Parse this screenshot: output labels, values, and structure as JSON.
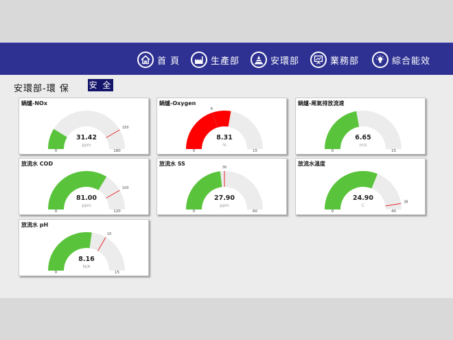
{
  "nav": {
    "items": [
      {
        "label": "首 頁",
        "icon": "home-icon"
      },
      {
        "label": "生產部",
        "icon": "factory-icon"
      },
      {
        "label": "安環部",
        "icon": "safety-cone-icon"
      },
      {
        "label": "業務部",
        "icon": "presentation-icon"
      },
      {
        "label": "綜合能效",
        "icon": "lightbulb-icon"
      }
    ]
  },
  "page": {
    "title": "安環部-環 保",
    "status": "安 全"
  },
  "colors": {
    "nav_bg": "#2e3192",
    "ok": "#59c43b",
    "alarm": "#ff0000",
    "track": "#ececec",
    "limit": "#e8262b"
  },
  "gauges": [
    {
      "title": "鍋爐-NOx",
      "value": 31.42,
      "value_text": "31.42",
      "unit": "ppm",
      "min": 0,
      "max": 180,
      "min_text": "0",
      "max_text": "180",
      "limit": 150,
      "limit_text": "150",
      "status": "normal"
    },
    {
      "title": "鍋爐-Oxygen",
      "value": 8.31,
      "value_text": "8.31",
      "unit": "%",
      "min": 0,
      "max": 15,
      "min_text": "0",
      "max_text": "15",
      "limit": 6,
      "limit_text": "6",
      "status": "alarm"
    },
    {
      "title": "鍋爐-尾氣排放流速",
      "value": 6.65,
      "value_text": "6.65",
      "unit": "m/s",
      "min": 0,
      "max": 15,
      "min_text": "0",
      "max_text": "15",
      "limit": null,
      "limit_text": "",
      "status": "normal"
    },
    {
      "title": "放流水 COD",
      "value": 81.0,
      "value_text": "81.00",
      "unit": "ppm",
      "min": 0,
      "max": 120,
      "min_text": "0",
      "max_text": "120",
      "limit": 100,
      "limit_text": "100",
      "status": "normal"
    },
    {
      "title": "放流水 SS",
      "value": 27.9,
      "value_text": "27.90",
      "unit": "ppm",
      "min": 0,
      "max": 60,
      "min_text": "0",
      "max_text": "60",
      "limit": 30,
      "limit_text": "30",
      "status": "normal"
    },
    {
      "title": "放流水溫度",
      "value": 24.9,
      "value_text": "24.90",
      "unit": "C",
      "min": 0,
      "max": 40,
      "min_text": "0",
      "max_text": "40",
      "limit": 38,
      "limit_text": "38",
      "status": "normal"
    },
    {
      "title": "放流水 pH",
      "value": 8.16,
      "value_text": "8.16",
      "unit": "N/A",
      "min": 0,
      "max": 15,
      "min_text": "0",
      "max_text": "15",
      "limit": 10,
      "limit_text": "10",
      "status": "normal"
    }
  ]
}
